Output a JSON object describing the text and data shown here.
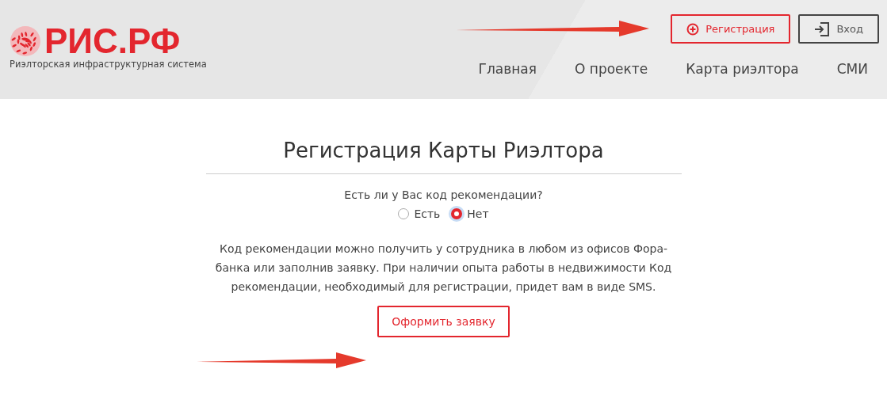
{
  "header": {
    "logo": {
      "title": "РИС.РФ",
      "subtitle": "Риэлторская инфраструктурная система"
    },
    "buttons": [
      {
        "kind": "register",
        "label": "Регистрация"
      },
      {
        "kind": "login",
        "label": "Вход"
      }
    ],
    "nav": [
      "Главная",
      "О проекте",
      "Карта риэлтора",
      "СМИ"
    ]
  },
  "form": {
    "title": "Регистрация Карты Риэлтора",
    "question": "Есть ли у Вас код рекомендации?",
    "options": [
      {
        "label": "Есть",
        "selected": false
      },
      {
        "label": "Нет",
        "selected": true
      }
    ],
    "info": "Код рекомендации можно получить у сотрудника в любом из офисов Фора-банка или заполнив заявку. При наличии опыта работы в недвижимости Код рекомендации, необходимый для регистрации, придет вам в виде SMS.",
    "submit": "Оформить заявку"
  }
}
